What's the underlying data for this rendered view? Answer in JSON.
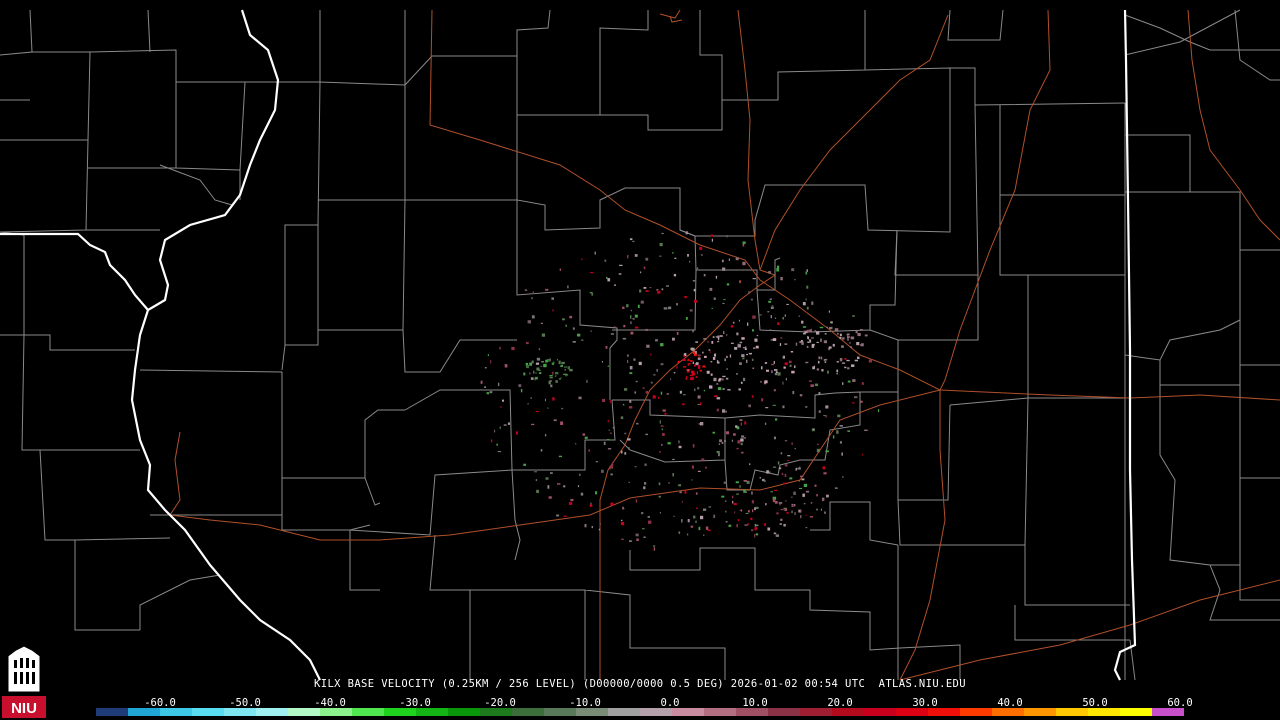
{
  "caption": "KILX BASE VELOCITY (0.25KM / 256 LEVEL) (D00000/0000 0.5 DEG) 2026-01-02 00:54 UTC  ATLAS.NIU.EDU",
  "logo": {
    "text": "NIU",
    "background": "#c8102e"
  },
  "colorbar": {
    "tick_labels": [
      "-60.0",
      "-50.0",
      "-40.0",
      "-30.0",
      "-20.0",
      "-10.0",
      "0.0",
      "10.0",
      "20.0",
      "30.0",
      "40.0",
      "50.0",
      "60.0"
    ],
    "tick_values": [
      -60,
      -50,
      -40,
      -30,
      -20,
      -10,
      0,
      10,
      20,
      30,
      40,
      50,
      60
    ],
    "range": [
      -64,
      64
    ],
    "colors": [
      "#1e3c78",
      "#1fa6d6",
      "#3cc8e6",
      "#5adcf0",
      "#7ee6f0",
      "#a0f0f0",
      "#b4f8c8",
      "#8cf08c",
      "#50e650",
      "#1ed21e",
      "#14b414",
      "#0a960a",
      "#1e7a1e",
      "#3c6e3c",
      "#5a785a",
      "#788c78",
      "#a0a0a0",
      "#b4a0aa",
      "#c88ca0",
      "#b46e82",
      "#a05064",
      "#8c3246",
      "#a01e32",
      "#b40a1e",
      "#c8001e",
      "#dc0014",
      "#f0100a",
      "#ff3c00",
      "#ff6e00",
      "#ff9600",
      "#ffc800",
      "#ffe600",
      "#ffff00",
      "#c850c8"
    ]
  },
  "colors": {
    "background": "#000000",
    "county_lines": "#8a8a8a",
    "roads": "#b0502a",
    "state_lines": "#ffffff"
  }
}
